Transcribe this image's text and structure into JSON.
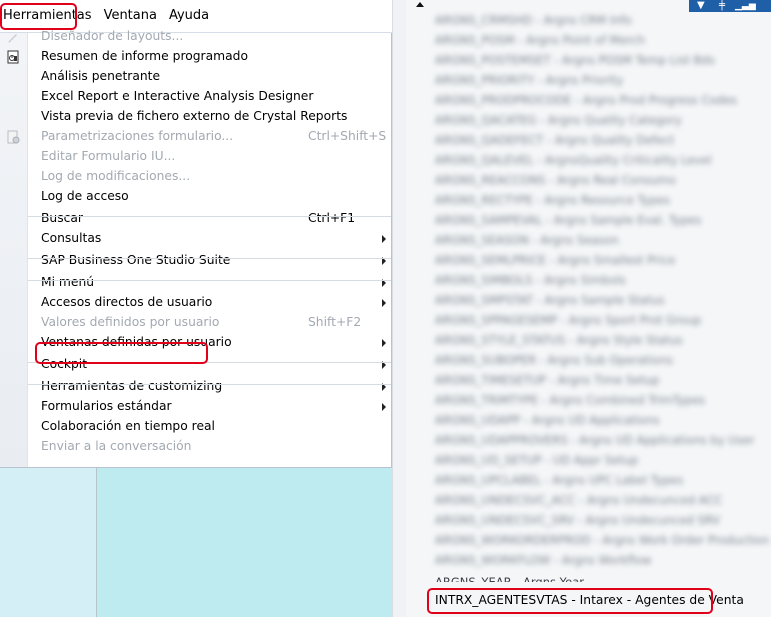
{
  "menubar": {
    "items": [
      {
        "label": "Herramientas"
      },
      {
        "label": "Ventana"
      },
      {
        "label": "Ayuda"
      }
    ]
  },
  "menu": {
    "items": [
      {
        "label": "Diseñador de layouts...",
        "shortcut": "",
        "disabled": true,
        "submenu": false,
        "icon": "pencil-icon"
      },
      {
        "label": "Resumen de informe programado",
        "shortcut": "",
        "disabled": false,
        "submenu": false,
        "icon": "report-icon"
      },
      {
        "label": "Análisis penetrante",
        "shortcut": "",
        "disabled": false,
        "submenu": false
      },
      {
        "label": "Excel Report e Interactive Analysis Designer",
        "shortcut": "",
        "disabled": false,
        "submenu": false
      },
      {
        "label": "Vista previa de fichero externo de Crystal Reports",
        "shortcut": "",
        "disabled": false,
        "submenu": false
      },
      {
        "label": "Parametrizaciones formulario...",
        "shortcut": "Ctrl+Shift+S",
        "disabled": true,
        "submenu": false,
        "icon": "form-settings-icon"
      },
      {
        "label": "Editar Formulario IU...",
        "shortcut": "",
        "disabled": true,
        "submenu": false
      },
      {
        "label": "Log de modificaciones...",
        "shortcut": "",
        "disabled": true,
        "submenu": false
      },
      {
        "label": "Log de acceso",
        "shortcut": "",
        "disabled": false,
        "submenu": false
      },
      {
        "label": "Buscar",
        "shortcut": "Ctrl+F1",
        "disabled": false,
        "submenu": false
      },
      {
        "label": "Consultas",
        "shortcut": "",
        "disabled": false,
        "submenu": true
      },
      {
        "label": "SAP Business One Studio Suite",
        "shortcut": "",
        "disabled": false,
        "submenu": true
      },
      {
        "label": "Mi menú",
        "shortcut": "",
        "disabled": false,
        "submenu": true
      },
      {
        "label": "Accesos directos de usuario",
        "shortcut": "",
        "disabled": false,
        "submenu": true
      },
      {
        "label": "Valores definidos por usuario",
        "shortcut": "Shift+F2",
        "disabled": true,
        "submenu": false
      },
      {
        "label": "Ventanas definidas por usuario",
        "shortcut": "",
        "disabled": false,
        "submenu": true,
        "highlighted": true
      },
      {
        "label": "Cockpit",
        "shortcut": "",
        "disabled": false,
        "submenu": true
      },
      {
        "label": "Herramientas de customizing",
        "shortcut": "",
        "disabled": false,
        "submenu": true
      },
      {
        "label": "Formularios estándar",
        "shortcut": "",
        "disabled": false,
        "submenu": true
      },
      {
        "label": "Colaboración en tiempo real",
        "shortcut": "",
        "disabled": false,
        "submenu": false
      },
      {
        "label": "Enviar a la conversación",
        "shortcut": "",
        "disabled": true,
        "submenu": false
      }
    ]
  },
  "udo_list": {
    "blurred_rows": [
      "ARGNS_CRMSHD - Argns CRM Info",
      "ARGNS_POSM - Argns Point of Merch",
      "ARGNS_POSTEMSET - Argns POSM Temp List Bds",
      "ARGNS_PRIORITY - Argns Priority",
      "ARGNS_PRODPROCODE - Argns Prod Progress Codes",
      "ARGNS_QACATEG - Argns Quality Category",
      "ARGNS_QADEFECT - Argns Quality Defect",
      "ARGNS_QALEVEL - ArgnsQuality Criticality Level",
      "ARGNS_REACCONS - Argns Real Consumo",
      "ARGNS_RECTYPE - Argns Resource Types",
      "ARGNS_SAMPEVAL - Argns Sample Eval. Types",
      "ARGNS_SEASON - Argns Season",
      "ARGNS_SEMLPRICE - Argns Smallest Price",
      "ARGNS_SIMBOLS - Argns Simbols",
      "ARGNS_SMPSTAT - Argns Sample Status",
      "ARGNS_SPPAGESEMP - Argns Sport Prot Group",
      "ARGNS_STYLE_STATUS - Argns Style Status",
      "ARGNS_SUBOPER - Argns Sub Operations",
      "ARGNS_TIMESETUP - Argns Time Setup",
      "ARGNS_TRIMTYPE - Argns Combined TrimTypes",
      "ARGNS_UDAPP - Argns UD Applications",
      "ARGNS_UDAPPROVERS - Argns UD Applications by User",
      "ARGNS_UD_SETUP - UD Appr Setup",
      "ARGNS_UPCLABEL - Argns UPC Label Types",
      "ARGNS_UNDECSVC_ACC - Argns Undecunced ACC",
      "ARGNS_UNDECSVC_SRV - Argns Undecunced SRV",
      "ARGNS_WORKORDERPROD - Argns Work Order Production",
      "ARGNS_WORKFLOW - Argns Workflow"
    ],
    "partial_row": "ARGNS_YEAR - Argns Year",
    "selected_row": "INTRX_AGENTESVTAS - Intarex - Agentes de Venta"
  },
  "colors": {
    "highlight_border": "#e0001a",
    "toolbar_blue": "#1f5fa8",
    "panel_cyan": "#bdebef"
  }
}
